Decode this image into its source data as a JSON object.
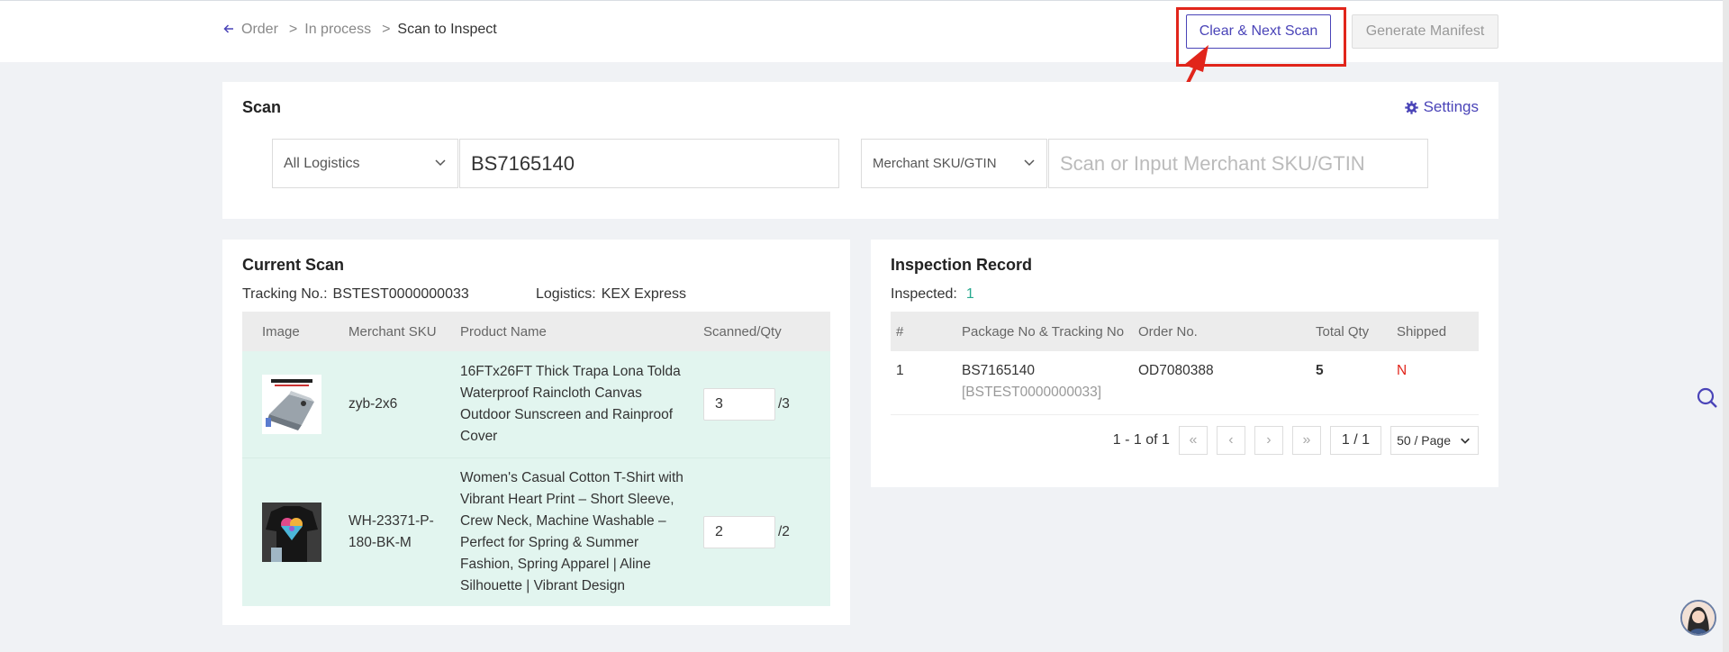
{
  "breadcrumb": {
    "back_icon": "arrow-left-icon",
    "order": "Order",
    "sep1": ">",
    "in_process": "In process",
    "sep2": ">",
    "current": "Scan to Inspect"
  },
  "header": {
    "clear_next_label": "Clear & Next Scan",
    "generate_manifest_label": "Generate Manifest"
  },
  "scan": {
    "title": "Scan",
    "settings_label": "Settings",
    "logistics_select": "All Logistics",
    "tracking_value": "BS7165140",
    "sku_select": "Merchant SKU/GTIN",
    "sku_placeholder": "Scan or Input Merchant SKU/GTIN"
  },
  "current_scan": {
    "title": "Current Scan",
    "tracking_label": "Tracking No.:",
    "tracking_value": "BSTEST0000000033",
    "logistics_label": "Logistics:",
    "logistics_value": "KEX Express",
    "columns": [
      "Image",
      "Merchant SKU",
      "Product Name",
      "Scanned/Qty"
    ],
    "rows": [
      {
        "image": "tarp-product-image",
        "sku": "zyb-2x6",
        "name": "16FTx26FT Thick Trapa Lona Tolda Waterproof Raincloth Canvas Outdoor Sunscreen and Rainproof Cover",
        "scanned": "3",
        "qty": "/3"
      },
      {
        "image": "tshirt-product-image",
        "sku": "WH-23371-P-180-BK-M",
        "name": "Women's Casual Cotton T-Shirt with Vibrant Heart Print – Short Sleeve, Crew Neck, Machine Washable – Perfect for Spring & Summer Fashion, Spring Apparel | Aline Silhouette | Vibrant Design",
        "scanned": "2",
        "qty": "/2"
      }
    ]
  },
  "inspection": {
    "title": "Inspection Record",
    "inspected_label": "Inspected:",
    "inspected_count": "1",
    "columns": [
      "#",
      "Package No & Tracking No",
      "Order No.",
      "Total Qty",
      "Shipped"
    ],
    "rows": [
      {
        "index": "1",
        "package_no": "BS7165140",
        "tracking_no": "[BSTEST0000000033]",
        "order_no": "OD7080388",
        "total_qty": "5",
        "shipped": "N"
      }
    ],
    "pager": {
      "range": "1 - 1 of 1",
      "page": "1 / 1",
      "page_size": "50 / Page"
    }
  },
  "colors": {
    "accent": "#4a44b8",
    "highlight": "#e1251b",
    "row_bg": "#e2f5ef",
    "teal": "#27a98f"
  }
}
